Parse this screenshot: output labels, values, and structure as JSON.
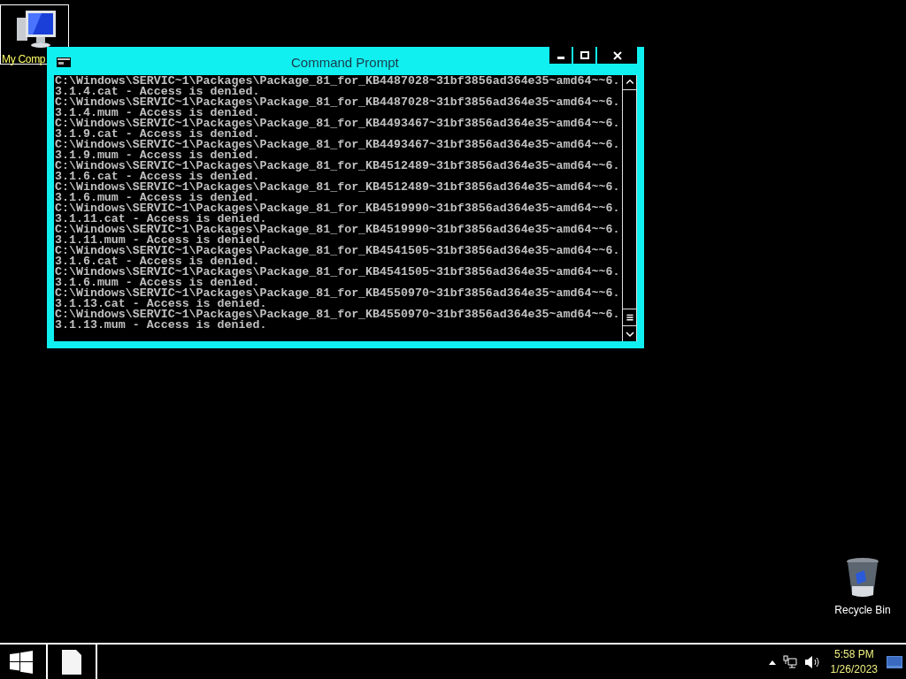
{
  "desktop_icons": [
    {
      "label": "My Comp",
      "selected": true
    },
    {
      "label": "Recycle Bin",
      "selected": false
    }
  ],
  "window": {
    "title": "Command Prompt",
    "buttons": [
      {
        "kind": "minimize"
      },
      {
        "kind": "maximize"
      },
      {
        "kind": "close"
      }
    ]
  },
  "console_lines": [
    "C:\\Windows\\SERVIC~1\\Packages\\Package_81_for_KB4487028~31bf3856ad364e35~amd64~~6.",
    "3.1.4.cat - Access is denied.",
    "C:\\Windows\\SERVIC~1\\Packages\\Package_81_for_KB4487028~31bf3856ad364e35~amd64~~6.",
    "3.1.4.mum - Access is denied.",
    "C:\\Windows\\SERVIC~1\\Packages\\Package_81_for_KB4493467~31bf3856ad364e35~amd64~~6.",
    "3.1.9.cat - Access is denied.",
    "C:\\Windows\\SERVIC~1\\Packages\\Package_81_for_KB4493467~31bf3856ad364e35~amd64~~6.",
    "3.1.9.mum - Access is denied.",
    "C:\\Windows\\SERVIC~1\\Packages\\Package_81_for_KB4512489~31bf3856ad364e35~amd64~~6.",
    "3.1.6.cat - Access is denied.",
    "C:\\Windows\\SERVIC~1\\Packages\\Package_81_for_KB4512489~31bf3856ad364e35~amd64~~6.",
    "3.1.6.mum - Access is denied.",
    "C:\\Windows\\SERVIC~1\\Packages\\Package_81_for_KB4519990~31bf3856ad364e35~amd64~~6.",
    "3.1.11.cat - Access is denied.",
    "C:\\Windows\\SERVIC~1\\Packages\\Package_81_for_KB4519990~31bf3856ad364e35~amd64~~6.",
    "3.1.11.mum - Access is denied.",
    "C:\\Windows\\SERVIC~1\\Packages\\Package_81_for_KB4541505~31bf3856ad364e35~amd64~~6.",
    "3.1.6.cat - Access is denied.",
    "C:\\Windows\\SERVIC~1\\Packages\\Package_81_for_KB4541505~31bf3856ad364e35~amd64~~6.",
    "3.1.6.mum - Access is denied.",
    "C:\\Windows\\SERVIC~1\\Packages\\Package_81_for_KB4550970~31bf3856ad364e35~amd64~~6.",
    "3.1.13.cat - Access is denied.",
    "C:\\Windows\\SERVIC~1\\Packages\\Package_81_for_KB4550970~31bf3856ad364e35~amd64~~6.",
    "3.1.13.mum - Access is denied."
  ],
  "taskbar": {
    "clock": {
      "time": "5:58 PM",
      "date": "1/26/2023"
    }
  }
}
